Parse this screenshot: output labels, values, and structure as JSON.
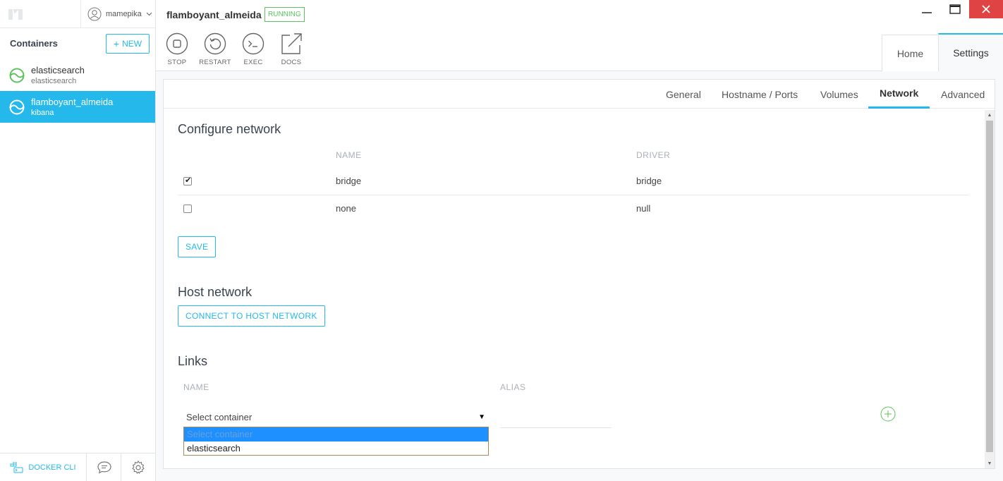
{
  "sidebar": {
    "user": "mamepika",
    "containers_title": "Containers",
    "new_label": "NEW",
    "containers": [
      {
        "name": "elasticsearch",
        "image": "elasticsearch",
        "status_color": "#5ec25e"
      },
      {
        "name": "flamboyant_almeida",
        "image": "kibana",
        "status_color": "#ffffff"
      }
    ],
    "docker_cli_label": "DOCKER CLI"
  },
  "header": {
    "container_name": "flamboyant_almeida",
    "status": "RUNNING",
    "tools": [
      {
        "label": "STOP",
        "icon": "stop-icon"
      },
      {
        "label": "RESTART",
        "icon": "restart-icon"
      },
      {
        "label": "EXEC",
        "icon": "terminal-icon"
      },
      {
        "label": "DOCS",
        "icon": "external-link-icon"
      }
    ],
    "tabs": {
      "home": "Home",
      "settings": "Settings"
    }
  },
  "settings_tabs": [
    "General",
    "Hostname / Ports",
    "Volumes",
    "Network",
    "Advanced"
  ],
  "active_settings_tab": "Network",
  "network": {
    "title": "Configure network",
    "col_name": "NAME",
    "col_driver": "DRIVER",
    "rows": [
      {
        "checked": true,
        "name": "bridge",
        "driver": "bridge"
      },
      {
        "checked": false,
        "name": "none",
        "driver": "null"
      }
    ],
    "save_label": "SAVE"
  },
  "host_network": {
    "title": "Host network",
    "button_label": "CONNECT TO HOST NETWORK"
  },
  "links": {
    "title": "Links",
    "col_name": "NAME",
    "col_alias": "ALIAS",
    "select_value": "Select container",
    "options": [
      "Select container",
      "elasticsearch"
    ],
    "alias_value": ""
  },
  "colors": {
    "accent": "#24b8eb",
    "running": "#5ec25e",
    "close": "#e04343"
  }
}
